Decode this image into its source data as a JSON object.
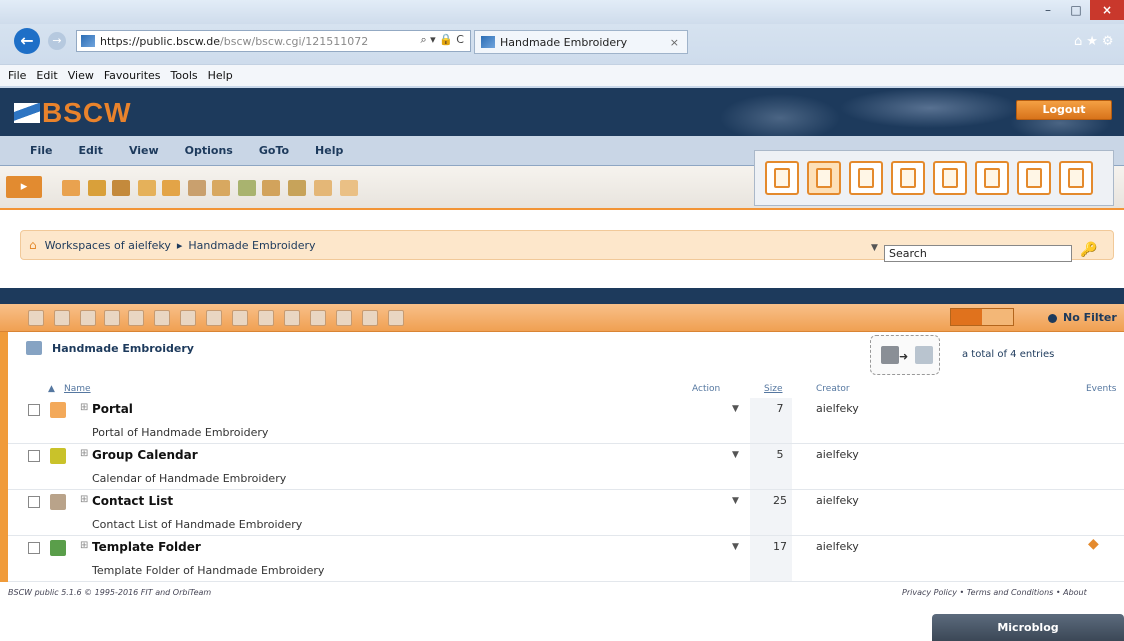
{
  "browser": {
    "url_host": "https://public.bscw.de",
    "url_path": "/bscw/bscw.cgi/121511072",
    "url_tools": "⌕ ▾ 🔒 C",
    "tab_title": "Handmade Embroidery",
    "tab_close": "×",
    "window_minimize": "–",
    "window_maximize": "□",
    "window_close": "×",
    "back": "←",
    "forward": "→",
    "right_icons": "⌂★⚙",
    "menu": [
      "File",
      "Edit",
      "View",
      "Favourites",
      "Tools",
      "Help"
    ]
  },
  "app": {
    "logo_text": "BSCW",
    "logout_label": "Logout",
    "menu": [
      "File",
      "Edit",
      "View",
      "Options",
      "GoTo",
      "Help"
    ]
  },
  "breadcrumb": {
    "root": "Workspaces of aielfeky",
    "separator": "▸",
    "current": "Handmade Embroidery"
  },
  "search": {
    "value": "Search",
    "dropdown": "▼"
  },
  "filter_label": "No Filter",
  "folder": {
    "title": "Handmade Embroidery",
    "total": "a total of 4 entries"
  },
  "columns": {
    "sort_arrow": "▲",
    "name": "Name",
    "action": "Action",
    "size": "Size",
    "creator": "Creator",
    "events": "Events"
  },
  "rows": [
    {
      "name": "Portal",
      "desc": "Portal of Handmade Embroidery",
      "size": "7",
      "creator": "aielfeky",
      "icon_color": "#f3a95a",
      "event": ""
    },
    {
      "name": "Group Calendar",
      "desc": "Calendar of Handmade Embroidery",
      "size": "5",
      "creator": "aielfeky",
      "icon_color": "#c9c22a",
      "event": ""
    },
    {
      "name": "Contact List",
      "desc": "Contact List of Handmade Embroidery",
      "size": "25",
      "creator": "aielfeky",
      "icon_color": "#b9a38a",
      "event": ""
    },
    {
      "name": "Template Folder",
      "desc": "Template Folder of Handmade Embroidery",
      "size": "17",
      "creator": "aielfeky",
      "icon_color": "#5a9e4a",
      "event": "◆"
    }
  ],
  "row_action": "▼",
  "row_expand": "⊞",
  "footer": {
    "left": "BSCW public 5.1.6 © 1995-2016 FIT and OrbiTeam",
    "right": "Privacy Policy • Terms and Conditions • About"
  },
  "microblog": "Microblog"
}
